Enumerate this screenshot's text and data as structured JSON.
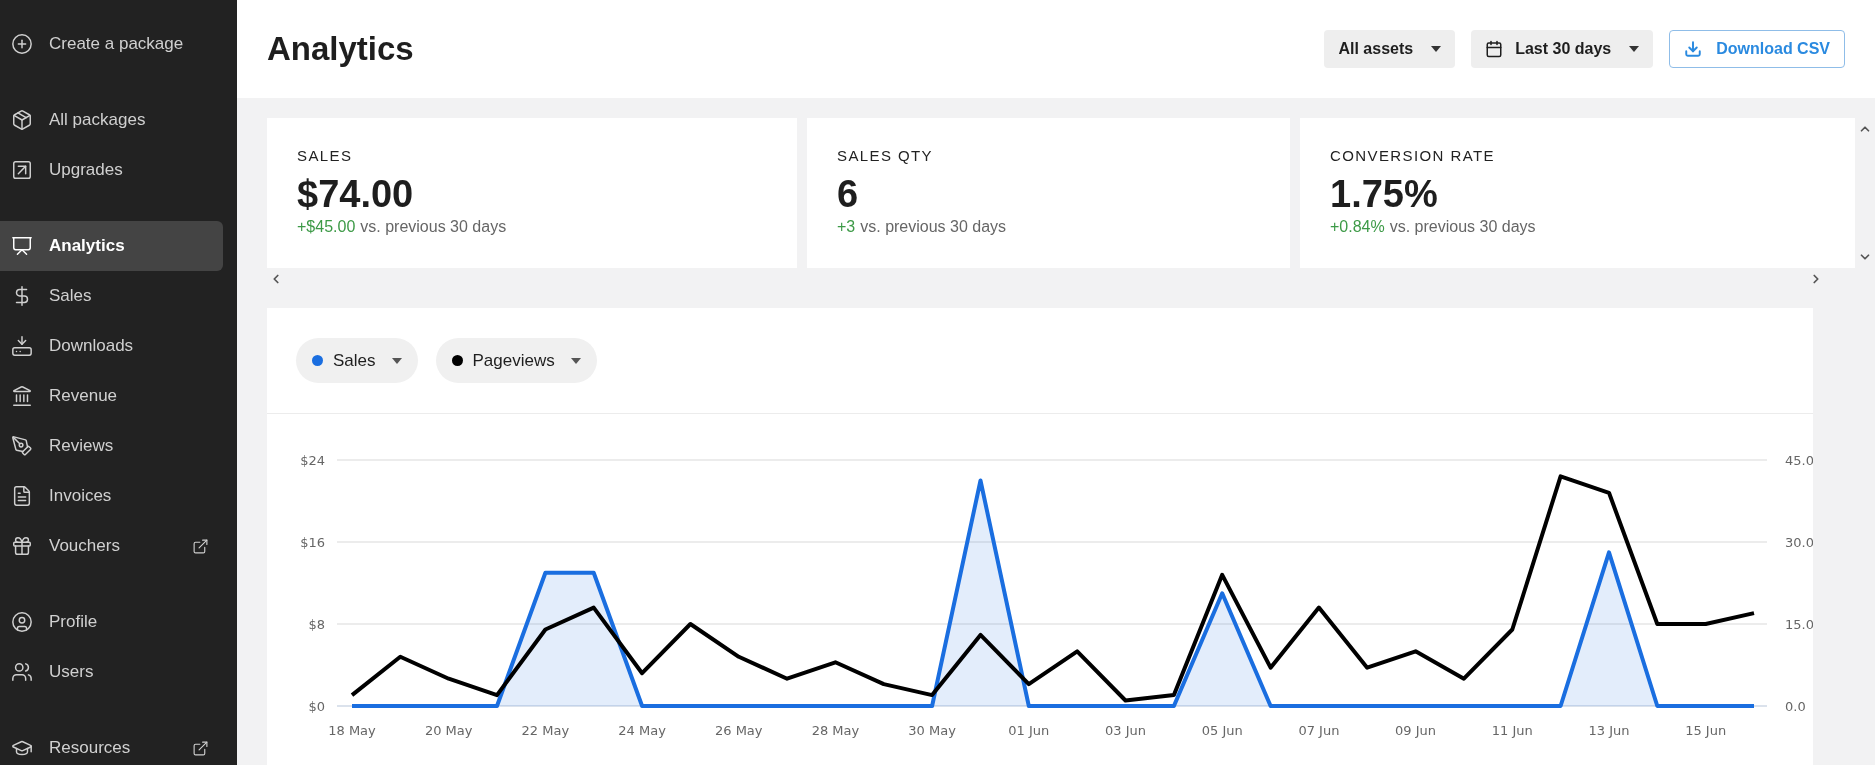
{
  "sidebar": {
    "groups": [
      {
        "items": [
          {
            "label": "Create a package",
            "selected": false,
            "external": false
          }
        ]
      },
      {
        "items": [
          {
            "label": "All packages",
            "selected": false,
            "external": false
          },
          {
            "label": "Upgrades",
            "selected": false,
            "external": false
          }
        ]
      },
      {
        "items": [
          {
            "label": "Analytics",
            "selected": true,
            "external": false
          },
          {
            "label": "Sales",
            "selected": false,
            "external": false
          },
          {
            "label": "Downloads",
            "selected": false,
            "external": false
          },
          {
            "label": "Revenue",
            "selected": false,
            "external": false
          },
          {
            "label": "Reviews",
            "selected": false,
            "external": false
          },
          {
            "label": "Invoices",
            "selected": false,
            "external": false
          },
          {
            "label": "Vouchers",
            "selected": false,
            "external": true
          }
        ]
      },
      {
        "items": [
          {
            "label": "Profile",
            "selected": false,
            "external": false
          },
          {
            "label": "Users",
            "selected": false,
            "external": false
          }
        ]
      },
      {
        "items": [
          {
            "label": "Resources",
            "selected": false,
            "external": true
          }
        ]
      }
    ]
  },
  "header": {
    "title": "Analytics",
    "filters": [
      {
        "kind": "dropdown",
        "label": "All assets"
      },
      {
        "kind": "date",
        "label": "Last 30 days"
      }
    ],
    "download_button": "Download CSV"
  },
  "stats": [
    {
      "label": "SALES",
      "value": "$74.00",
      "delta": "+$45.00",
      "comparison": "vs. previous 30 days"
    },
    {
      "label": "SALES QTY",
      "value": "6",
      "delta": "+3",
      "comparison": "vs. previous 30 days"
    },
    {
      "label": "CONVERSION RATE",
      "value": "1.75%",
      "delta": "+0.84%",
      "comparison": "vs. previous 30 days"
    }
  ],
  "chart": {
    "chart_data": {
      "type": "line",
      "categories": [
        "18 May",
        null,
        "20 May",
        null,
        "22 May",
        null,
        "24 May",
        null,
        "26 May",
        null,
        "28 May",
        null,
        "30 May",
        null,
        "01 Jun",
        null,
        "03 Jun",
        null,
        "05 Jun",
        null,
        "07 Jun",
        null,
        "09 Jun",
        null,
        "11 Jun",
        null,
        "13 Jun",
        null,
        "15 Jun",
        null
      ],
      "ylim": [
        0,
        24
      ],
      "yticks": [
        {
          "value": 0,
          "label": "$0"
        },
        {
          "value": 8,
          "label": "$8"
        },
        {
          "value": 16,
          "label": "$16"
        },
        {
          "value": 24,
          "label": "$24"
        }
      ],
      "y2lim": [
        0,
        45
      ],
      "y2ticks": [
        {
          "value": 0,
          "label": "0.0"
        },
        {
          "value": 15,
          "label": "15.0"
        },
        {
          "value": 30,
          "label": "30.0"
        },
        {
          "value": 45,
          "label": "45.0"
        }
      ],
      "series": [
        {
          "name": "Sales",
          "color": "#1a6ee0",
          "type": "area",
          "values": [
            0,
            0,
            0,
            0,
            13,
            13,
            0,
            0,
            0,
            0,
            0,
            0,
            0,
            22,
            0,
            0,
            0,
            0,
            11,
            0,
            0,
            0,
            0,
            0,
            0,
            0,
            15,
            0,
            0,
            0
          ]
        },
        {
          "name": "Pageviews",
          "color": "#000000",
          "axis": "y2",
          "values": [
            2,
            9,
            5,
            2,
            14,
            18,
            6,
            15,
            9,
            5,
            8,
            4,
            2,
            13,
            4,
            10,
            1,
            2,
            24,
            7,
            18,
            7,
            10,
            5,
            14,
            42,
            39,
            15,
            15,
            17
          ]
        }
      ]
    }
  }
}
